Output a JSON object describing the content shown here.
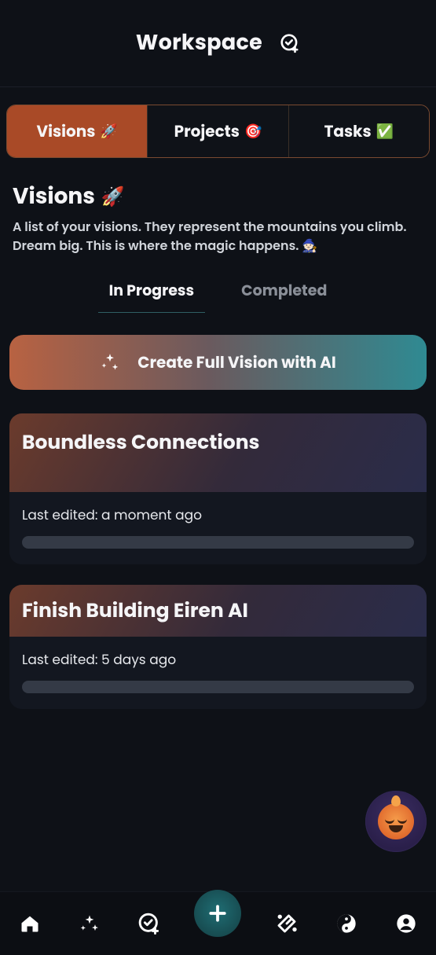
{
  "top": {
    "title": "Workspace"
  },
  "tabs": [
    {
      "label": "Visions",
      "emoji": "🚀",
      "active": true
    },
    {
      "label": "Projects",
      "emoji": "🎯",
      "active": false
    },
    {
      "label": "Tasks",
      "emoji": "✅",
      "active": false
    }
  ],
  "section": {
    "title": "Visions",
    "title_emoji": "🚀",
    "description": "A list of your visions. They represent the mountains you climb. Dream big. This is where the magic happens.",
    "desc_emoji": "🧙🏻"
  },
  "subtabs": {
    "inprogress": "In Progress",
    "completed": "Completed",
    "active": "inprogress"
  },
  "cta": {
    "label": "Create Full Vision with AI"
  },
  "visions": [
    {
      "title": "Boundless Connections",
      "meta": "Last edited: a moment ago",
      "progress_pct": 0
    },
    {
      "title": "Finish Building Eiren AI",
      "meta": "Last edited: 5 days ago",
      "progress_pct": 0
    }
  ],
  "nav": {
    "items": [
      "home",
      "sparkles",
      "check-add",
      "add",
      "magic",
      "yinyang",
      "account"
    ]
  }
}
